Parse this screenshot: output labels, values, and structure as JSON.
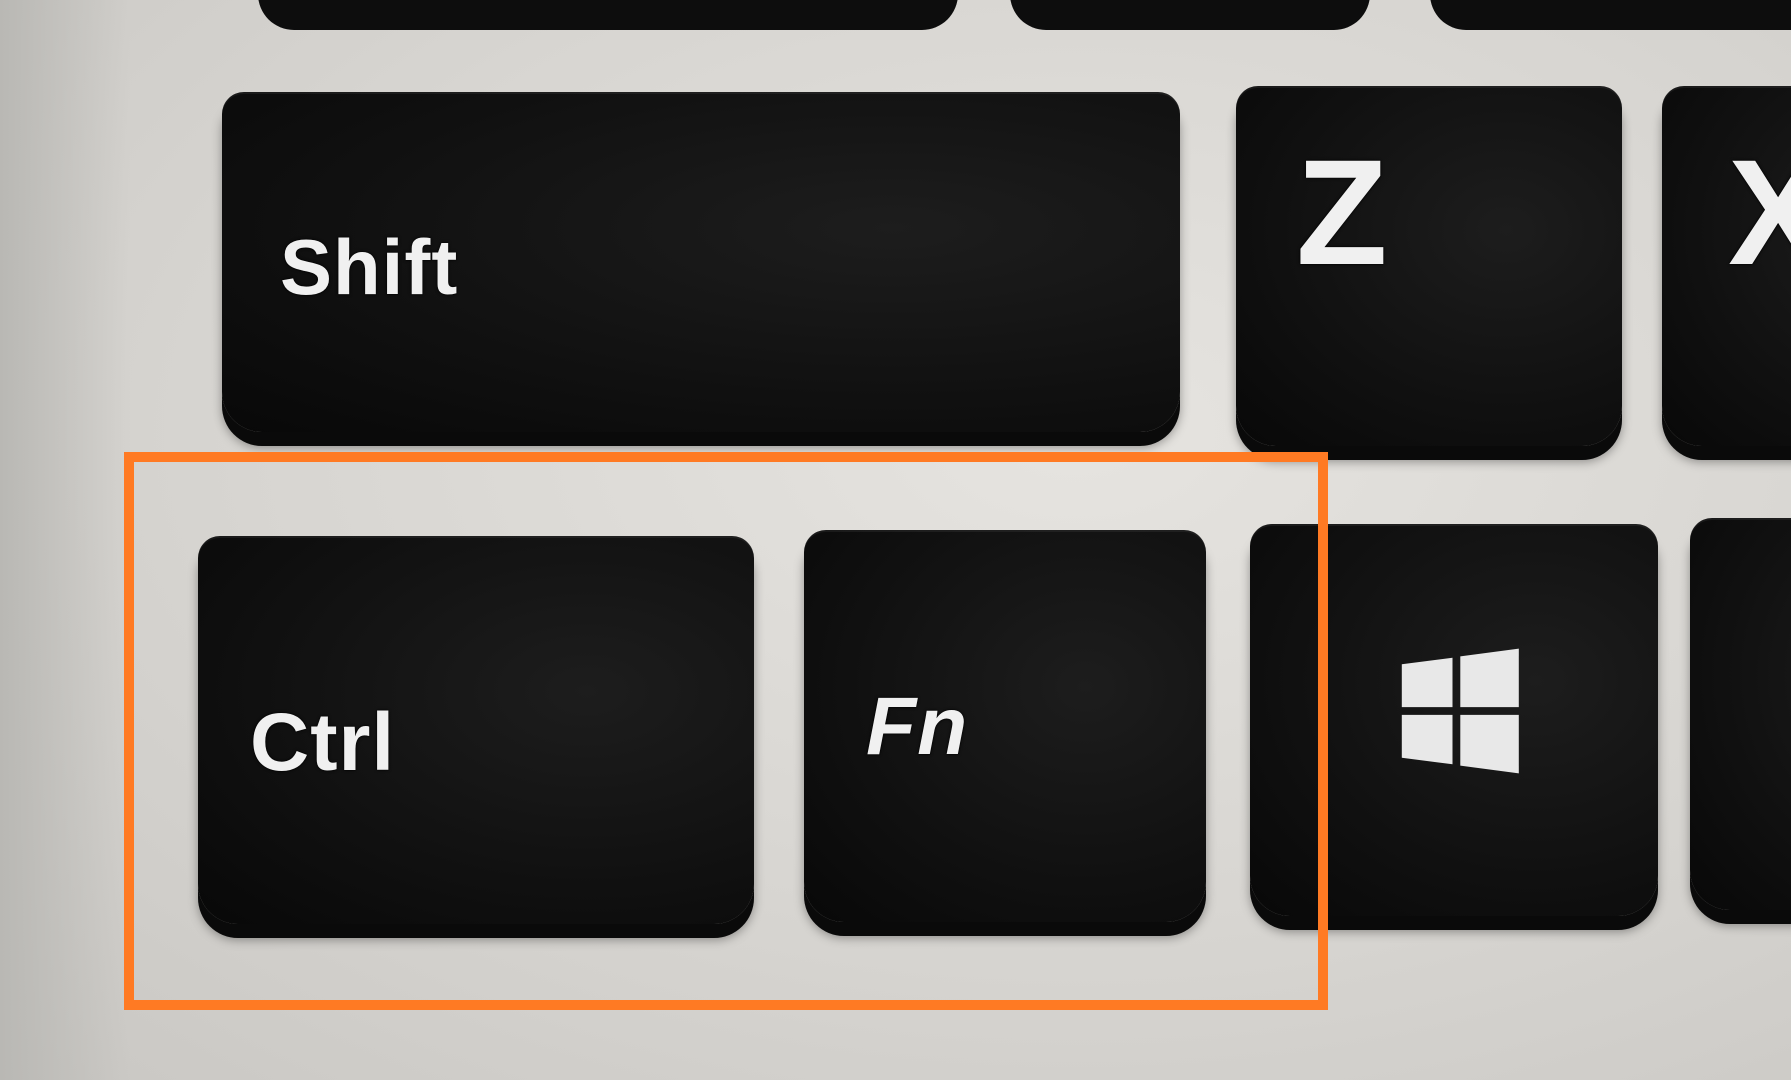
{
  "keys": {
    "shift": "Shift",
    "z": "Z",
    "x": "X",
    "ctrl": "Ctrl",
    "fn": "Fn",
    "windows": "windows-icon"
  },
  "highlight": {
    "color": "#ff7a23",
    "target": [
      "Ctrl",
      "Fn"
    ]
  }
}
